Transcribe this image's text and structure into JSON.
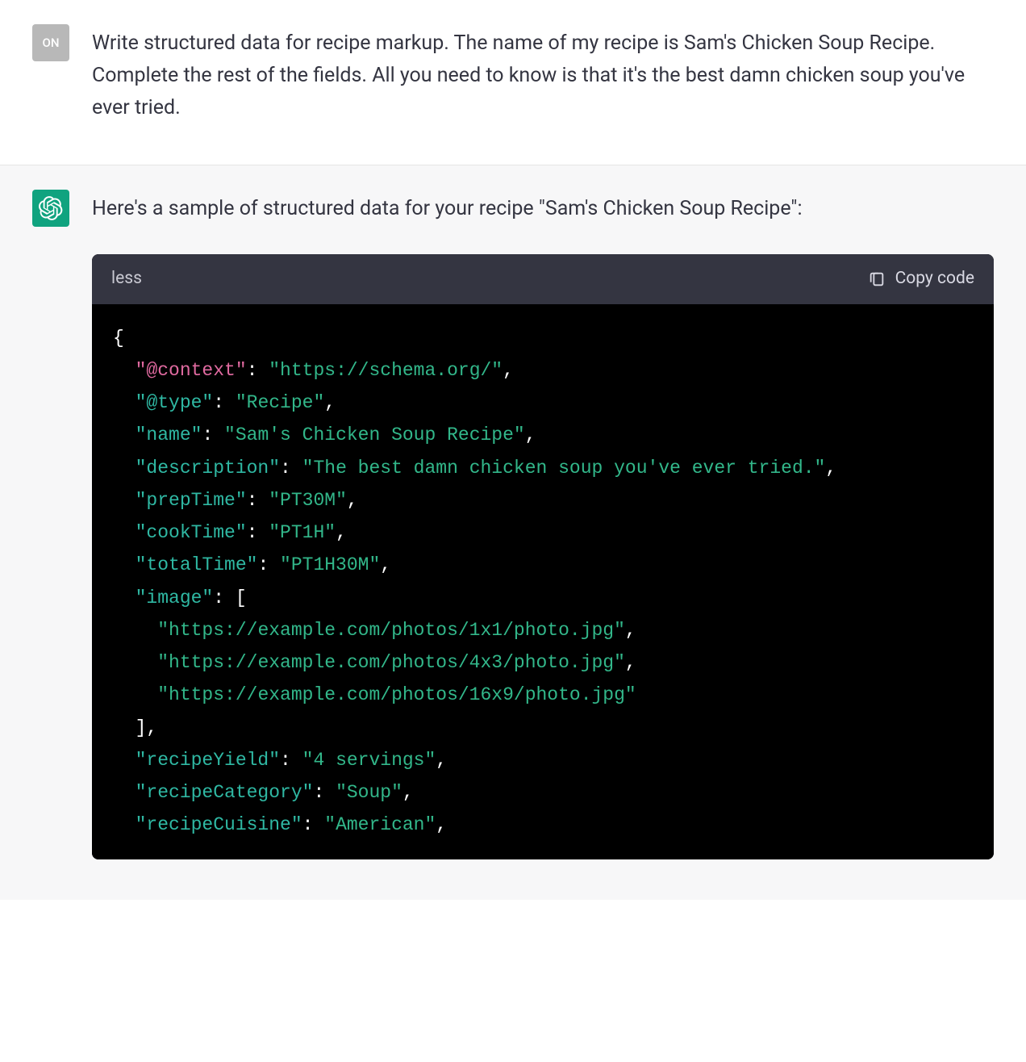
{
  "user": {
    "avatar_label": "ON",
    "message": "Write structured data for recipe markup. The name of my recipe is Sam's Chicken Soup Recipe. Complete the rest of the fields. All you need to know is that it's the best damn chicken soup you've ever tried."
  },
  "assistant": {
    "message": "Here's a sample of structured data for your recipe \"Sam's Chicken Soup Recipe\":"
  },
  "code": {
    "language": "less",
    "copy_label": "Copy code",
    "json": {
      "context_key": "\"@context\"",
      "context_val": "\"https://schema.org/\"",
      "type_key": "\"@type\"",
      "type_val": "\"Recipe\"",
      "name_key": "\"name\"",
      "name_val": "\"Sam's Chicken Soup Recipe\"",
      "desc_key": "\"description\"",
      "desc_val": "\"The best damn chicken soup you've ever tried.\"",
      "prep_key": "\"prepTime\"",
      "prep_val": "\"PT30M\"",
      "cook_key": "\"cookTime\"",
      "cook_val": "\"PT1H\"",
      "total_key": "\"totalTime\"",
      "total_val": "\"PT1H30M\"",
      "image_key": "\"image\"",
      "image_0": "\"https://example.com/photos/1x1/photo.jpg\"",
      "image_1": "\"https://example.com/photos/4x3/photo.jpg\"",
      "image_2": "\"https://example.com/photos/16x9/photo.jpg\"",
      "yield_key": "\"recipeYield\"",
      "yield_val": "\"4 servings\"",
      "cat_key": "\"recipeCategory\"",
      "cat_val": "\"Soup\"",
      "cuisine_key": "\"recipeCuisine\"",
      "cuisine_val": "\"American\""
    }
  }
}
